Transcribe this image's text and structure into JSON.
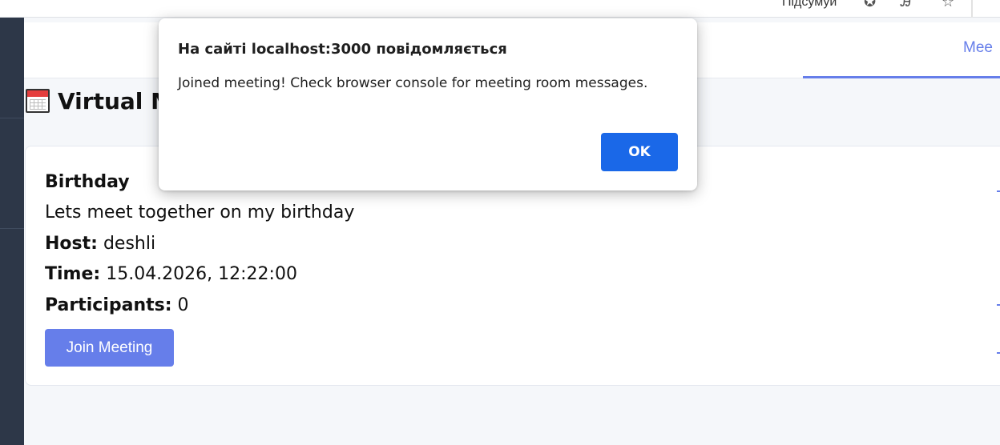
{
  "browser": {
    "summarize_label": "Підсумуй",
    "icons": [
      "copilot-icon",
      "reader-icon",
      "favorite-star-icon"
    ]
  },
  "nav": {
    "active_tab_label": "Mee"
  },
  "page": {
    "title": "Virtual M",
    "icon": "calendar-icon"
  },
  "meeting": {
    "name": "Birthday",
    "description": "Lets meet together on my birthday",
    "host_label": "Host:",
    "host": "deshli",
    "time_label": "Time:",
    "time": "15.04.2026, 12:22:00",
    "participants_label": "Participants:",
    "participants": "0",
    "join_label": "Join Meeting"
  },
  "dialog": {
    "title": "На сайті localhost:3000 повідомляється",
    "message": "Joined meeting! Check browser console for meeting room messages.",
    "ok_label": "OK"
  },
  "colors": {
    "accent": "#667eea",
    "ok_button": "#1a68e8",
    "rail": "#2d3748"
  }
}
